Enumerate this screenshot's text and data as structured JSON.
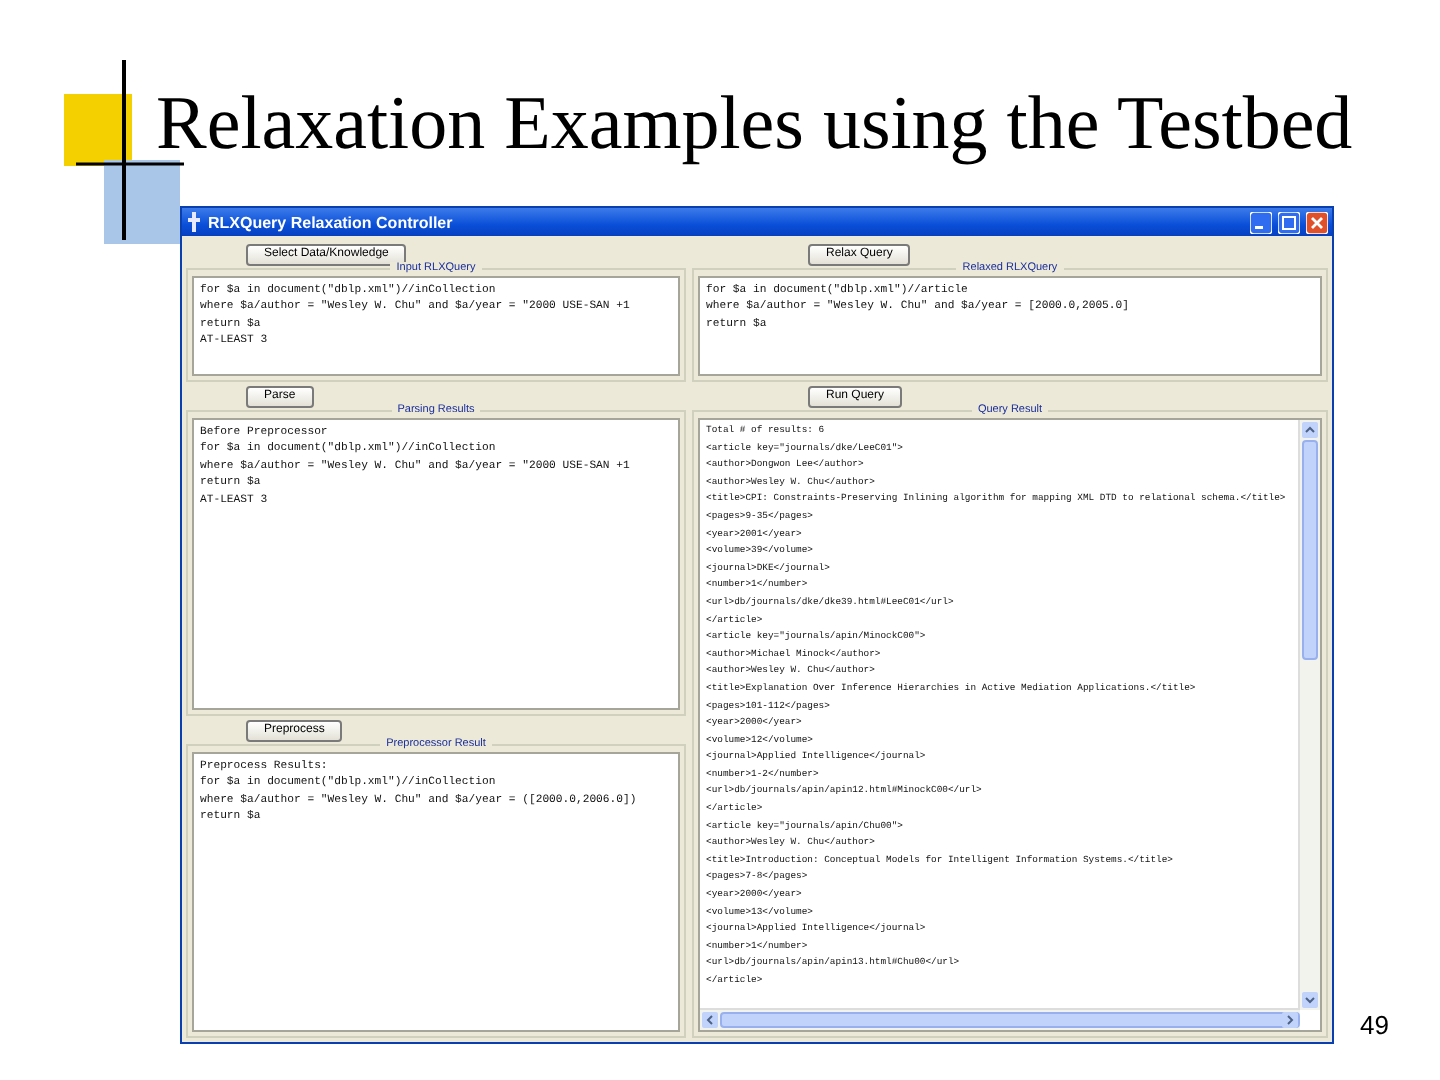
{
  "slide": {
    "title": "Relaxation Examples using the Testbed",
    "page_number": "49"
  },
  "window": {
    "title": "RLXQuery Relaxation Controller",
    "left_column": [
      {
        "button": "Select Data/Knowledge",
        "group": "Input RLXQuery",
        "lines": [
          "for $a in document(\"dblp.xml\")//inCollection",
          "where $a/author = \"Wesley W. Chu\" and $a/year = \"2000 USE-SAN +1",
          "return $a",
          "AT-LEAST 3"
        ]
      },
      {
        "button": "Parse",
        "group": "Parsing Results",
        "lines": [
          "Before Preprocessor",
          "for $a in document(\"dblp.xml\")//inCollection",
          "where $a/author = \"Wesley W. Chu\" and $a/year = \"2000 USE-SAN +1",
          "return $a",
          "AT-LEAST 3"
        ]
      },
      {
        "button": "Preprocess",
        "group": "Preprocessor Result",
        "lines": [
          "Preprocess Results:",
          "for $a in document(\"dblp.xml\")//inCollection",
          "where $a/author = \"Wesley W. Chu\" and $a/year = ([2000.0,2006.0])",
          "return $a"
        ]
      }
    ],
    "right_column": [
      {
        "button": "Relax Query",
        "group": "Relaxed RLXQuery",
        "lines": [
          "for $a in document(\"dblp.xml\")//article",
          "where $a/author = \"Wesley W. Chu\" and $a/year = [2000.0,2005.0]",
          "return $a"
        ]
      },
      {
        "button": "Run Query",
        "group": "Query Result",
        "scrollbars": true,
        "lines": [
          "Total # of results: 6",
          "<article key=\"journals/dke/LeeC01\">",
          "<author>Dongwon Lee</author>",
          "<author>Wesley W. Chu</author>",
          "<title>CPI: Constraints-Preserving Inlining algorithm for mapping XML DTD to relational schema.</title>",
          "<pages>9-35</pages>",
          "<year>2001</year>",
          "<volume>39</volume>",
          "<journal>DKE</journal>",
          "<number>1</number>",
          "<url>db/journals/dke/dke39.html#LeeC01</url>",
          "</article>",
          "<article key=\"journals/apin/MinockC00\">",
          "<author>Michael Minock</author>",
          "<author>Wesley W. Chu</author>",
          "<title>Explanation Over Inference Hierarchies in Active Mediation Applications.</title>",
          "<pages>101-112</pages>",
          "<year>2000</year>",
          "<volume>12</volume>",
          "<journal>Applied Intelligence</journal>",
          "<number>1-2</number>",
          "<url>db/journals/apin/apin12.html#MinockC00</url>",
          "</article>",
          "<article key=\"journals/apin/Chu00\">",
          "<author>Wesley W. Chu</author>",
          "<title>Introduction: Conceptual Models for Intelligent Information Systems.</title>",
          "<pages>7-8</pages>",
          "<year>2000</year>",
          "<volume>13</volume>",
          "<journal>Applied Intelligence</journal>",
          "<number>1</number>",
          "<url>db/journals/apin/apin13.html#Chu00</url>",
          "</article>"
        ]
      }
    ]
  }
}
